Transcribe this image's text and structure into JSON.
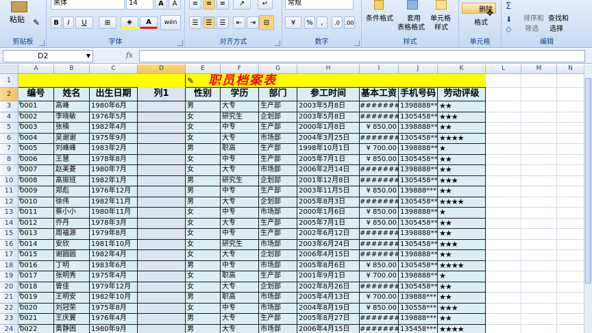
{
  "ribbon": {
    "clipboard": {
      "label": "剪贴板",
      "paste": "粘贴"
    },
    "font": {
      "label": "字体",
      "font_name": "黑体",
      "font_size": "14",
      "bold": "B",
      "italic": "I",
      "underline": "U",
      "phonetic": "wén"
    },
    "alignment": {
      "label": "对齐方式"
    },
    "number": {
      "label": "数字",
      "format": "常规",
      "percent": "%",
      "comma": ","
    },
    "styles": {
      "label": "样式",
      "conditional": "条件格式",
      "table": "套用",
      "table2": "表格格式",
      "cell_style": "单元格",
      "cell_style2": "样式"
    },
    "cells": {
      "label": "单元格",
      "delete": "删除",
      "format": "格式"
    },
    "editing": {
      "label": "编辑",
      "sort": "排序和",
      "filter": "筛选",
      "find": "查找和",
      "select": "选择"
    }
  },
  "formula_bar": {
    "name_box": "D2",
    "fx": "fx",
    "formula": ""
  },
  "columns": [
    "A",
    "B",
    "C",
    "D",
    "E",
    "F",
    "G",
    "H",
    "I",
    "J",
    "K",
    "L",
    "M",
    "N"
  ],
  "title": "职员档案表",
  "headers": [
    "编号",
    "姓名",
    "出生日期",
    "列1",
    "性别",
    "学历",
    "部门",
    "参工时间",
    "基本工资",
    "手机号码",
    "劳动评级"
  ],
  "rows": [
    [
      "0001",
      "高峰",
      "1980年6月",
      "",
      "男",
      "大专",
      "生产部",
      "2003年5月8日",
      "########",
      "1398888***7",
      "★★"
    ],
    [
      "0002",
      "李晓敏",
      "1976年5月",
      "",
      "女",
      "研究生",
      "企划部",
      "2003年5月8日",
      "########",
      "1305458***4",
      "★★★"
    ],
    [
      "0003",
      "张楠",
      "1982年4月",
      "",
      "女",
      "中专",
      "生产部",
      "2000年1月8日",
      "¥ 850.00",
      "1398888***6",
      "★★"
    ],
    [
      "0004",
      "吴谢谢",
      "1975年9月",
      "",
      "女",
      "大专",
      "市场部",
      "2004年3月25日",
      "########",
      "1305458***2",
      "★★★★"
    ],
    [
      "0005",
      "刘峰峰",
      "1983年2月",
      "",
      "男",
      "职高",
      "生产部",
      "1998年10月1日",
      "¥ 700.00",
      "1398888***5",
      "★"
    ],
    [
      "0006",
      "王慧",
      "1978年8月",
      "",
      "女",
      "中专",
      "生产部",
      "2005年7月1日",
      "¥ 850.00",
      "1305458***3",
      "★★"
    ],
    [
      "0007",
      "赵美菱",
      "1980年7月",
      "",
      "女",
      "大专",
      "市场部",
      "2006年2月14日",
      "########",
      "1398888***1",
      "★★"
    ],
    [
      "0008",
      "高振班",
      "1982年1月",
      "",
      "男",
      "研究生",
      "企划部",
      "2001年12月8日",
      "########",
      "1305458***4",
      "★★★"
    ],
    [
      "0009",
      "郑彪",
      "1976年12月",
      "",
      "男",
      "中专",
      "生产部",
      "2003年11月5日",
      "¥ 850.00",
      "139888***11",
      "★★"
    ],
    [
      "0010",
      "徐伟",
      "1982年11月",
      "",
      "男",
      "大专",
      "企划部",
      "2005年8月3日",
      "########",
      "1305458***5",
      "★★★★"
    ],
    [
      "0011",
      "蔡小小",
      "1980年11月",
      "",
      "女",
      "中专",
      "市场部",
      "2000年1月6日",
      "¥ 850.00",
      "1398888***8",
      "★"
    ],
    [
      "0012",
      "乔丹",
      "1978年3月",
      "",
      "女",
      "大专",
      "生产部",
      "2005年7月1日",
      "¥ 850.00",
      "1305458***6",
      "★★"
    ],
    [
      "0013",
      "周福源",
      "1979年8月",
      "",
      "女",
      "中专",
      "生产部",
      "2002年6月12日",
      "########",
      "1398888***3",
      "★★"
    ],
    [
      "0014",
      "安欣",
      "1981年10月",
      "",
      "女",
      "研究生",
      "市场部",
      "2003年6月24日",
      "########",
      "1305458***7",
      "★★★"
    ],
    [
      "0015",
      "谢圆圆",
      "1982年4月",
      "",
      "女",
      "大专",
      "企划部",
      "2006年4月15日",
      "########",
      "1398888***4",
      "★★"
    ],
    [
      "0016",
      "丁明",
      "1983年6月",
      "",
      "男",
      "中专",
      "市场部",
      "2005年8月6日",
      "¥ 850.00",
      "1305458***8",
      "★★★★"
    ],
    [
      "0017",
      "张明秀",
      "1975年4月",
      "",
      "女",
      "职高",
      "生产部",
      "2001年9月1日",
      "¥ 700.00",
      "1398888***9",
      "★"
    ],
    [
      "0018",
      "曾佳",
      "1979年12月",
      "",
      "女",
      "大专",
      "企划部",
      "2002年8月26日",
      "########",
      "1305458***9",
      "★★"
    ],
    [
      "0019",
      "王明安",
      "1982年10月",
      "",
      "男",
      "职高",
      "市场部",
      "2005年4月13日",
      "¥ 700.00",
      "139888***16",
      "★★"
    ],
    [
      "0020",
      "刘冠荣",
      "1975年8月",
      "",
      "女",
      "中专",
      "市场部",
      "2004年8月19日",
      "¥ 850.00",
      "130558***10",
      "★★★"
    ],
    [
      "0021",
      "王庆翼",
      "1976年4月",
      "",
      "男",
      "大专",
      "生产部",
      "2005年8月27日",
      "########",
      "139888***17",
      "★★"
    ],
    [
      "0022",
      "黄静困",
      "1980年9月",
      "",
      "男",
      "大专",
      "市场部",
      "2006年4月15日",
      "########",
      "135458***16",
      "★★★★"
    ]
  ]
}
